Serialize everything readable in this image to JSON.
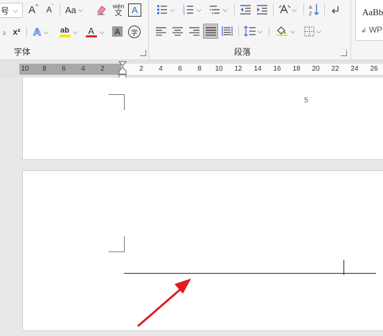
{
  "ribbon": {
    "font_group_label": "字体",
    "paragraph_group_label": "段落",
    "font_size_partial": "号",
    "change_case_label": "Aa",
    "pinyin_top": "wén",
    "pinyin_bottom": "文",
    "superscript_label": "x²",
    "subscript_label": "₂",
    "char_border_label": "A",
    "grow_font_label": "A",
    "shrink_font_label": "A",
    "text_effect_label": "A",
    "highlight_label": "ab",
    "font_color_label": "A",
    "char_shading_label": "A",
    "enclose_char_label": "字",
    "styles": {
      "style1": "AaBb",
      "style2": "WPS"
    },
    "colors": {
      "highlight": "#f5e600",
      "font_color": "#e02020",
      "text_effect": "#2b6cd9"
    }
  },
  "ruler": {
    "left_ticks": [
      "10",
      "8",
      "6",
      "4",
      "2"
    ],
    "right_ticks": [
      "2",
      "4",
      "6",
      "8",
      "10",
      "12",
      "14",
      "16",
      "18",
      "20",
      "22",
      "24",
      "26"
    ]
  },
  "document": {
    "page_number": "5",
    "annotation": {
      "type": "arrow",
      "color": "#e01b1b",
      "points_to": "horizontal-line"
    }
  }
}
